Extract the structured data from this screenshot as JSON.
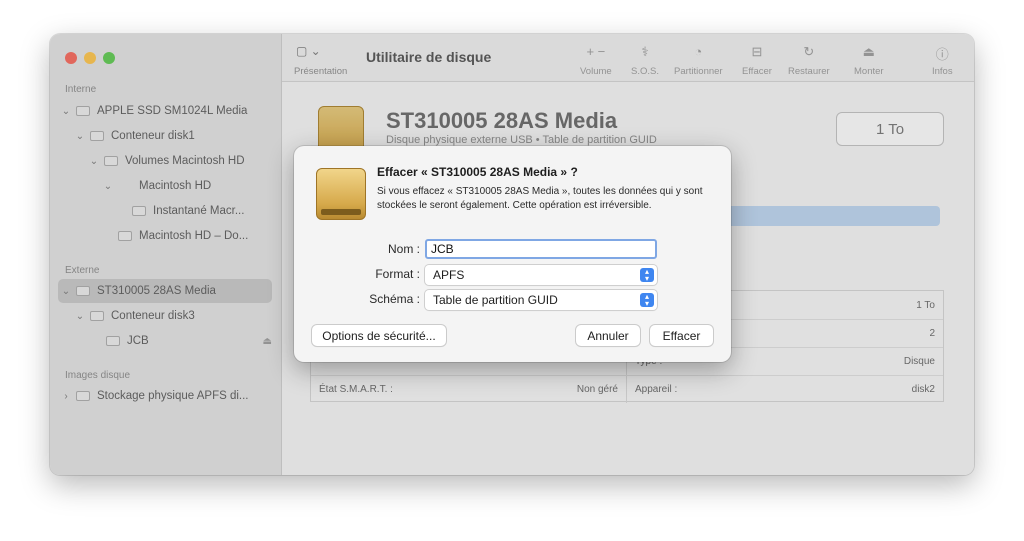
{
  "toolbar": {
    "title": "Utilitaire de disque",
    "view_label": "Présentation",
    "buttons": [
      {
        "label": "Volume",
        "icon": "plus-minus-icon"
      },
      {
        "label": "S.O.S.",
        "icon": "stethoscope-icon"
      },
      {
        "label": "Partitionner",
        "icon": "pie-icon"
      },
      {
        "label": "Effacer",
        "icon": "erase-icon"
      },
      {
        "label": "Restaurer",
        "icon": "restore-icon"
      },
      {
        "label": "Monter",
        "icon": "mount-icon"
      },
      {
        "label": "Infos",
        "icon": "info-icon"
      }
    ]
  },
  "sidebar": {
    "section_internal": "Interne",
    "section_external": "Externe",
    "section_images": "Images disque",
    "items": [
      {
        "label": "APPLE SSD SM1024L Media"
      },
      {
        "label": "Conteneur disk1"
      },
      {
        "label": "Volumes Macintosh HD"
      },
      {
        "label": "Macintosh HD"
      },
      {
        "label": "Instantané Macr..."
      },
      {
        "label": "Macintosh HD – Do..."
      },
      {
        "label": "ST310005 28AS Media"
      },
      {
        "label": "Conteneur disk3"
      },
      {
        "label": "JCB"
      },
      {
        "label": "Stockage physique APFS di..."
      }
    ]
  },
  "main": {
    "drive_name": "ST310005 28AS Media",
    "drive_subtitle": "Disque physique externe USB • Table de partition GUID",
    "capacity": "1 To",
    "info": {
      "right_col": [
        {
          "label": "",
          "value": "1 To"
        },
        {
          "label": "",
          "value": "2"
        },
        {
          "label": "Type :",
          "value": "Disque"
        },
        {
          "label": "Appareil :",
          "value": "disk2"
        }
      ],
      "smart_label": "État S.M.A.R.T. :",
      "smart_value": "Non géré"
    }
  },
  "dialog": {
    "title": "Effacer « ST310005 28AS Media » ?",
    "message": "Si vous effacez « ST310005 28AS Media », toutes les données qui y sont stockées le seront également. Cette opération est irréversible.",
    "name_label": "Nom :",
    "name_value": "JCB",
    "format_label": "Format :",
    "format_value": "APFS",
    "scheme_label": "Schéma :",
    "scheme_value": "Table de partition GUID",
    "security_button": "Options de sécurité...",
    "cancel_button": "Annuler",
    "erase_button": "Effacer"
  }
}
